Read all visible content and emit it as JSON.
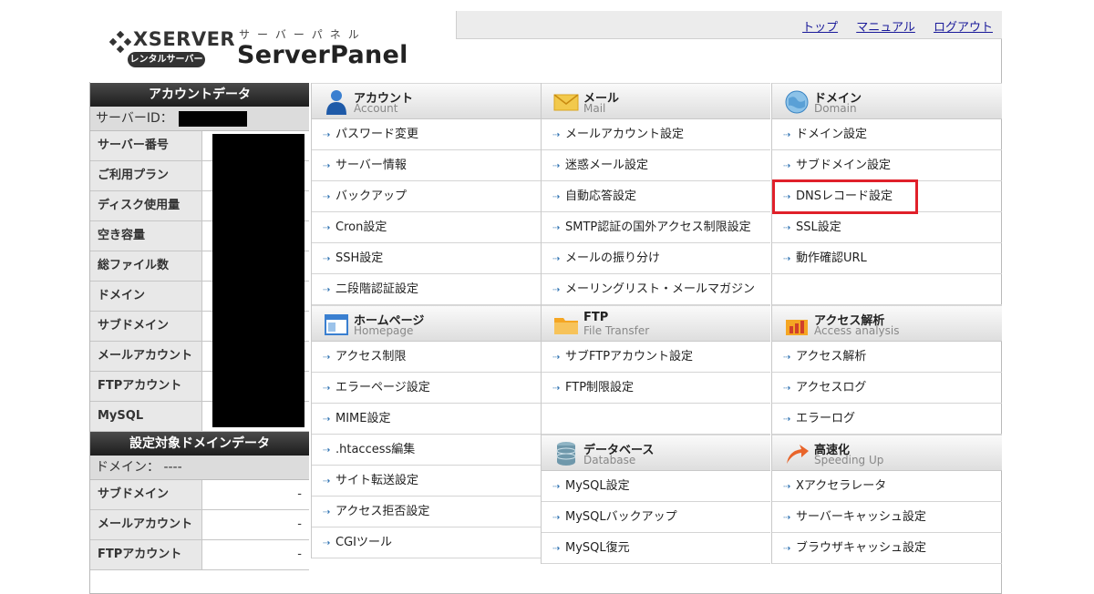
{
  "header": {
    "brand": "XSERVER",
    "brand_badge": "レンタルサーバー",
    "panel_kana": "サーバーパネル",
    "panel_title": "ServerPanel",
    "links": [
      "トップ",
      "マニュアル",
      "ログアウト"
    ]
  },
  "account": {
    "heading": "アカウントデータ",
    "id_label": "サーバーID：",
    "rows": [
      "サーバー番号",
      "ご利用プラン",
      "ディスク使用量",
      "空き容量",
      "総ファイル数",
      "ドメイン",
      "サブドメイン",
      "メールアカウント",
      "FTPアカウント",
      "MySQL"
    ]
  },
  "domain_data": {
    "heading": "設定対象ドメインデータ",
    "domain_line": "ドメイン： ----",
    "rows": [
      {
        "label": "サブドメイン",
        "value": "-"
      },
      {
        "label": "メールアカウント",
        "value": "-"
      },
      {
        "label": "FTPアカウント",
        "value": "-"
      }
    ]
  },
  "menu": {
    "account": {
      "jp": "アカウント",
      "en": "Account",
      "items": [
        "パスワード変更",
        "サーバー情報",
        "バックアップ",
        "Cron設定",
        "SSH設定",
        "二段階認証設定"
      ]
    },
    "homepage": {
      "jp": "ホームページ",
      "en": "Homepage",
      "items": [
        "アクセス制限",
        "エラーページ設定",
        "MIME設定",
        ".htaccess編集",
        "サイト転送設定",
        "アクセス拒否設定",
        "CGIツール"
      ]
    },
    "mail": {
      "jp": "メール",
      "en": "Mail",
      "items": [
        "メールアカウント設定",
        "迷惑メール設定",
        "自動応答設定",
        "SMTP認証の国外アクセス制限設定",
        "メールの振り分け",
        "メーリングリスト・メールマガジン"
      ]
    },
    "ftp": {
      "jp": "FTP",
      "en": "File Transfer",
      "items": [
        "サブFTPアカウント設定",
        "FTP制限設定"
      ]
    },
    "database": {
      "jp": "データベース",
      "en": "Database",
      "items": [
        "MySQL設定",
        "MySQLバックアップ",
        "MySQL復元"
      ]
    },
    "domain": {
      "jp": "ドメイン",
      "en": "Domain",
      "items": [
        "ドメイン設定",
        "サブドメイン設定",
        "DNSレコード設定",
        "SSL設定",
        "動作確認URL"
      ]
    },
    "access": {
      "jp": "アクセス解析",
      "en": "Access analysis",
      "items": [
        "アクセス解析",
        "アクセスログ",
        "エラーログ"
      ]
    },
    "speed": {
      "jp": "高速化",
      "en": "Speeding Up",
      "items": [
        "Xアクセラレータ",
        "サーバーキャッシュ設定",
        "ブラウザキャッシュ設定"
      ]
    }
  },
  "colors": {
    "highlight": "#e0202a",
    "link": "#1a1a9a",
    "arrow": "#2a6fb0"
  }
}
